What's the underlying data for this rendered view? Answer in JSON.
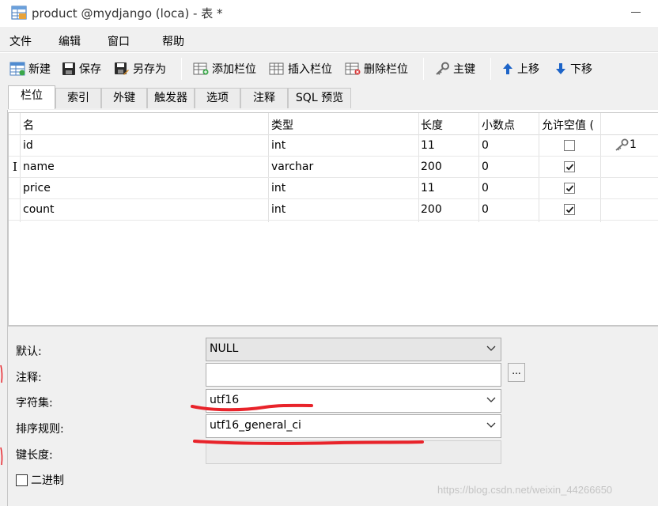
{
  "window": {
    "title": "product @mydjango (loca) - 表 *"
  },
  "menu": {
    "items": [
      {
        "label": "文件"
      },
      {
        "label": "编辑"
      },
      {
        "label": "窗口"
      },
      {
        "label": "帮助"
      }
    ]
  },
  "toolbar": {
    "new_label": "新建",
    "save_label": "保存",
    "save_as_label": "另存为",
    "add_column_label": "添加栏位",
    "insert_column_label": "插入栏位",
    "delete_column_label": "删除栏位",
    "primary_key_label": "主键",
    "move_up_label": "上移",
    "move_down_label": "下移"
  },
  "tabs": [
    {
      "label": "栏位",
      "active": true
    },
    {
      "label": "索引"
    },
    {
      "label": "外键"
    },
    {
      "label": "触发器"
    },
    {
      "label": "选项"
    },
    {
      "label": "注释"
    },
    {
      "label": "SQL 预览"
    }
  ],
  "grid": {
    "headers": {
      "name": "名",
      "type": "类型",
      "length": "长度",
      "decimals": "小数点",
      "nullable": "允许空值 ("
    },
    "rows": [
      {
        "name": "id",
        "type": "int",
        "length": "11",
        "decimals": "0",
        "nullable": false,
        "key": "1"
      },
      {
        "name": "name",
        "type": "varchar",
        "length": "200",
        "decimals": "0",
        "nullable": true,
        "key": ""
      },
      {
        "name": "price",
        "type": "int",
        "length": "11",
        "decimals": "0",
        "nullable": true,
        "key": ""
      },
      {
        "name": "count",
        "type": "int",
        "length": "200",
        "decimals": "0",
        "nullable": true,
        "key": ""
      }
    ],
    "cursor_glyph": "I"
  },
  "form": {
    "default_label": "默认:",
    "default_value": "NULL",
    "comment_label": "注释:",
    "comment_value": "",
    "dots_label": "...",
    "charset_label": "字符集:",
    "charset_value": "utf16",
    "collation_label": "排序规则:",
    "collation_value": "utf16_general_ci",
    "key_length_label": "键长度:",
    "key_length_value": "",
    "binary_label": "二进制",
    "binary_checked": false
  },
  "watermark": "https://blog.csdn.net/weixin_44266650",
  "colors": {
    "annotation": "#e8232a",
    "toolbar_bg": "#f0f0f0",
    "arrow_blue": "#1d64c8"
  }
}
